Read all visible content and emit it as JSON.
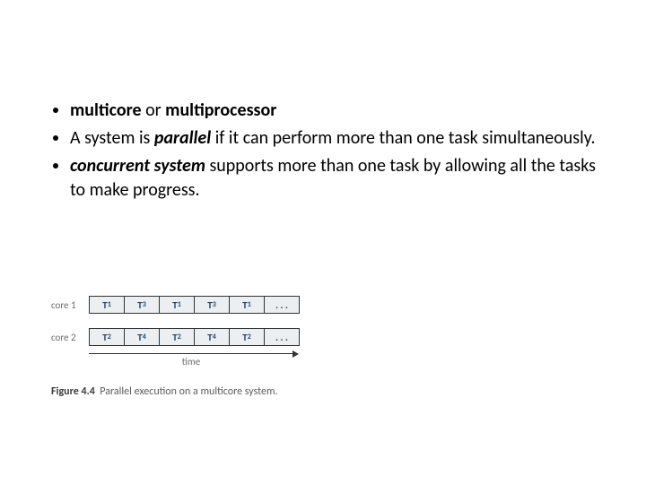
{
  "bullets": [
    {
      "b1_pre_bold": "multicore",
      "b1_mid": " or ",
      "b1_post_bold": "multiprocessor"
    },
    {
      "b2_pre": "A system is ",
      "b2_bi": "parallel",
      "b2_post": " if it can perform more than one task simultaneously."
    },
    {
      "b3_bi": "concurrent system",
      "b3_post": " supports more than one task by allowing all the tasks to make progress."
    }
  ],
  "chart_data": {
    "type": "table",
    "title": "Parallel execution on a multicore system.",
    "xlabel": "time",
    "rows": [
      {
        "label": "core 1",
        "cells": [
          "T1",
          "T3",
          "T1",
          "T3",
          "T1",
          ". . ."
        ]
      },
      {
        "label": "core 2",
        "cells": [
          "T2",
          "T4",
          "T2",
          "T4",
          "T2",
          ". . ."
        ]
      }
    ]
  },
  "caption": {
    "fignum": "Figure 4.4",
    "text": "Parallel execution on a multicore system."
  }
}
